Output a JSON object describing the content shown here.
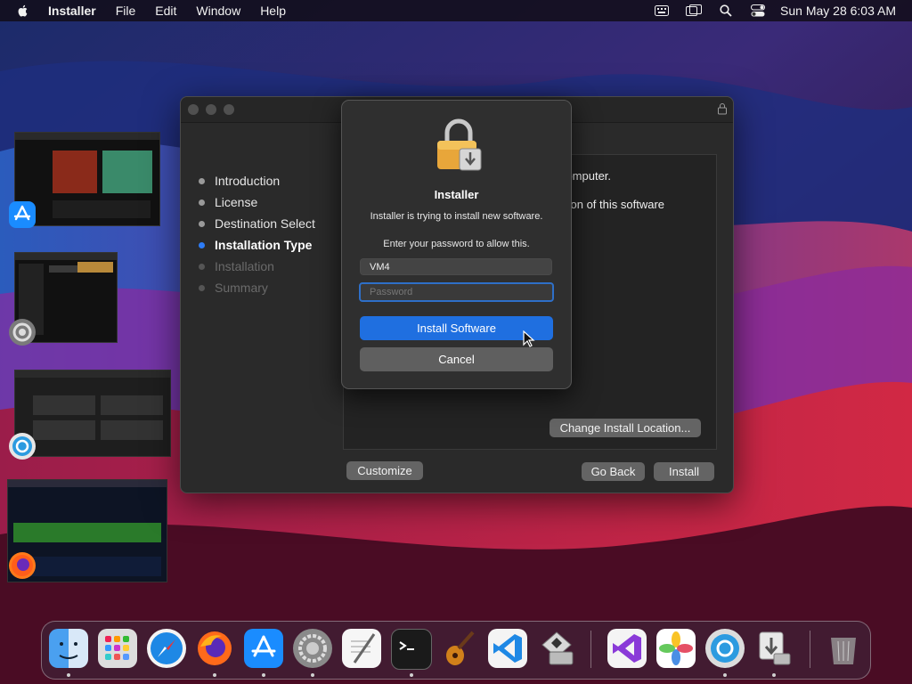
{
  "menubar": {
    "app_name": "Installer",
    "menus": [
      "File",
      "Edit",
      "Window",
      "Help"
    ],
    "clock": "Sun May 28  6:03 AM",
    "status_icons": [
      "keyboard-icon",
      "screen-mirror-icon",
      "search-icon",
      "control-center-icon"
    ]
  },
  "stage_manager": [
    {
      "app": "App Store",
      "icon": "app-store-icon"
    },
    {
      "app": "System Preferences",
      "icon": "system-preferences-icon"
    },
    {
      "app": "OpenCore Legacy Patcher",
      "icon": "opencore-icon"
    },
    {
      "app": "Firefox",
      "icon": "firefox-icon"
    }
  ],
  "installer": {
    "steps": [
      {
        "label": "Introduction",
        "state": "done"
      },
      {
        "label": "License",
        "state": "done"
      },
      {
        "label": "Destination Select",
        "state": "done"
      },
      {
        "label": "Installation Type",
        "state": "active"
      },
      {
        "label": "Installation",
        "state": "pending"
      },
      {
        "label": "Summary",
        "state": "pending"
      }
    ],
    "pane_text_1": "r computer.",
    "pane_text_2": "llation of this software",
    "change_location_label": "Change Install Location...",
    "customize_label": "Customize",
    "go_back_label": "Go Back",
    "install_label": "Install"
  },
  "auth_dialog": {
    "title": "Installer",
    "message": "Installer is trying to install new software.",
    "prompt": "Enter your password to allow this.",
    "username_value": "VM4",
    "password_placeholder": "Password",
    "install_button": "Install Software",
    "cancel_button": "Cancel"
  },
  "dock": {
    "apps": [
      {
        "name": "Finder",
        "icon": "finder-icon",
        "running": true
      },
      {
        "name": "Launchpad",
        "icon": "launchpad-icon",
        "running": false
      },
      {
        "name": "Safari",
        "icon": "safari-icon",
        "running": false
      },
      {
        "name": "Firefox",
        "icon": "firefox-icon",
        "running": true
      },
      {
        "name": "App Store",
        "icon": "app-store-icon",
        "running": true
      },
      {
        "name": "System Preferences",
        "icon": "system-preferences-icon",
        "running": true
      },
      {
        "name": "TextEdit",
        "icon": "textedit-icon",
        "running": false
      },
      {
        "name": "Terminal",
        "icon": "terminal-icon",
        "running": true
      },
      {
        "name": "GarageBand",
        "icon": "garageband-icon",
        "running": false
      },
      {
        "name": "Visual Studio Code",
        "icon": "vscode-icon",
        "running": false
      },
      {
        "name": "Disk Utility",
        "icon": "disk-utility-icon",
        "running": false
      },
      {
        "name": "Visual Studio",
        "icon": "visual-studio-icon",
        "running": false
      },
      {
        "name": "Photos",
        "icon": "photos-icon",
        "running": false
      },
      {
        "name": "OpenCore Legacy Patcher",
        "icon": "opencore-icon",
        "running": true
      },
      {
        "name": "Installer",
        "icon": "installer-icon",
        "running": true
      },
      {
        "name": "Trash",
        "icon": "trash-icon",
        "running": false
      }
    ]
  },
  "colors": {
    "accent": "#1f6fe0",
    "active_step_dot": "#2d7cf6",
    "window_bg": "#2a2a2a"
  }
}
